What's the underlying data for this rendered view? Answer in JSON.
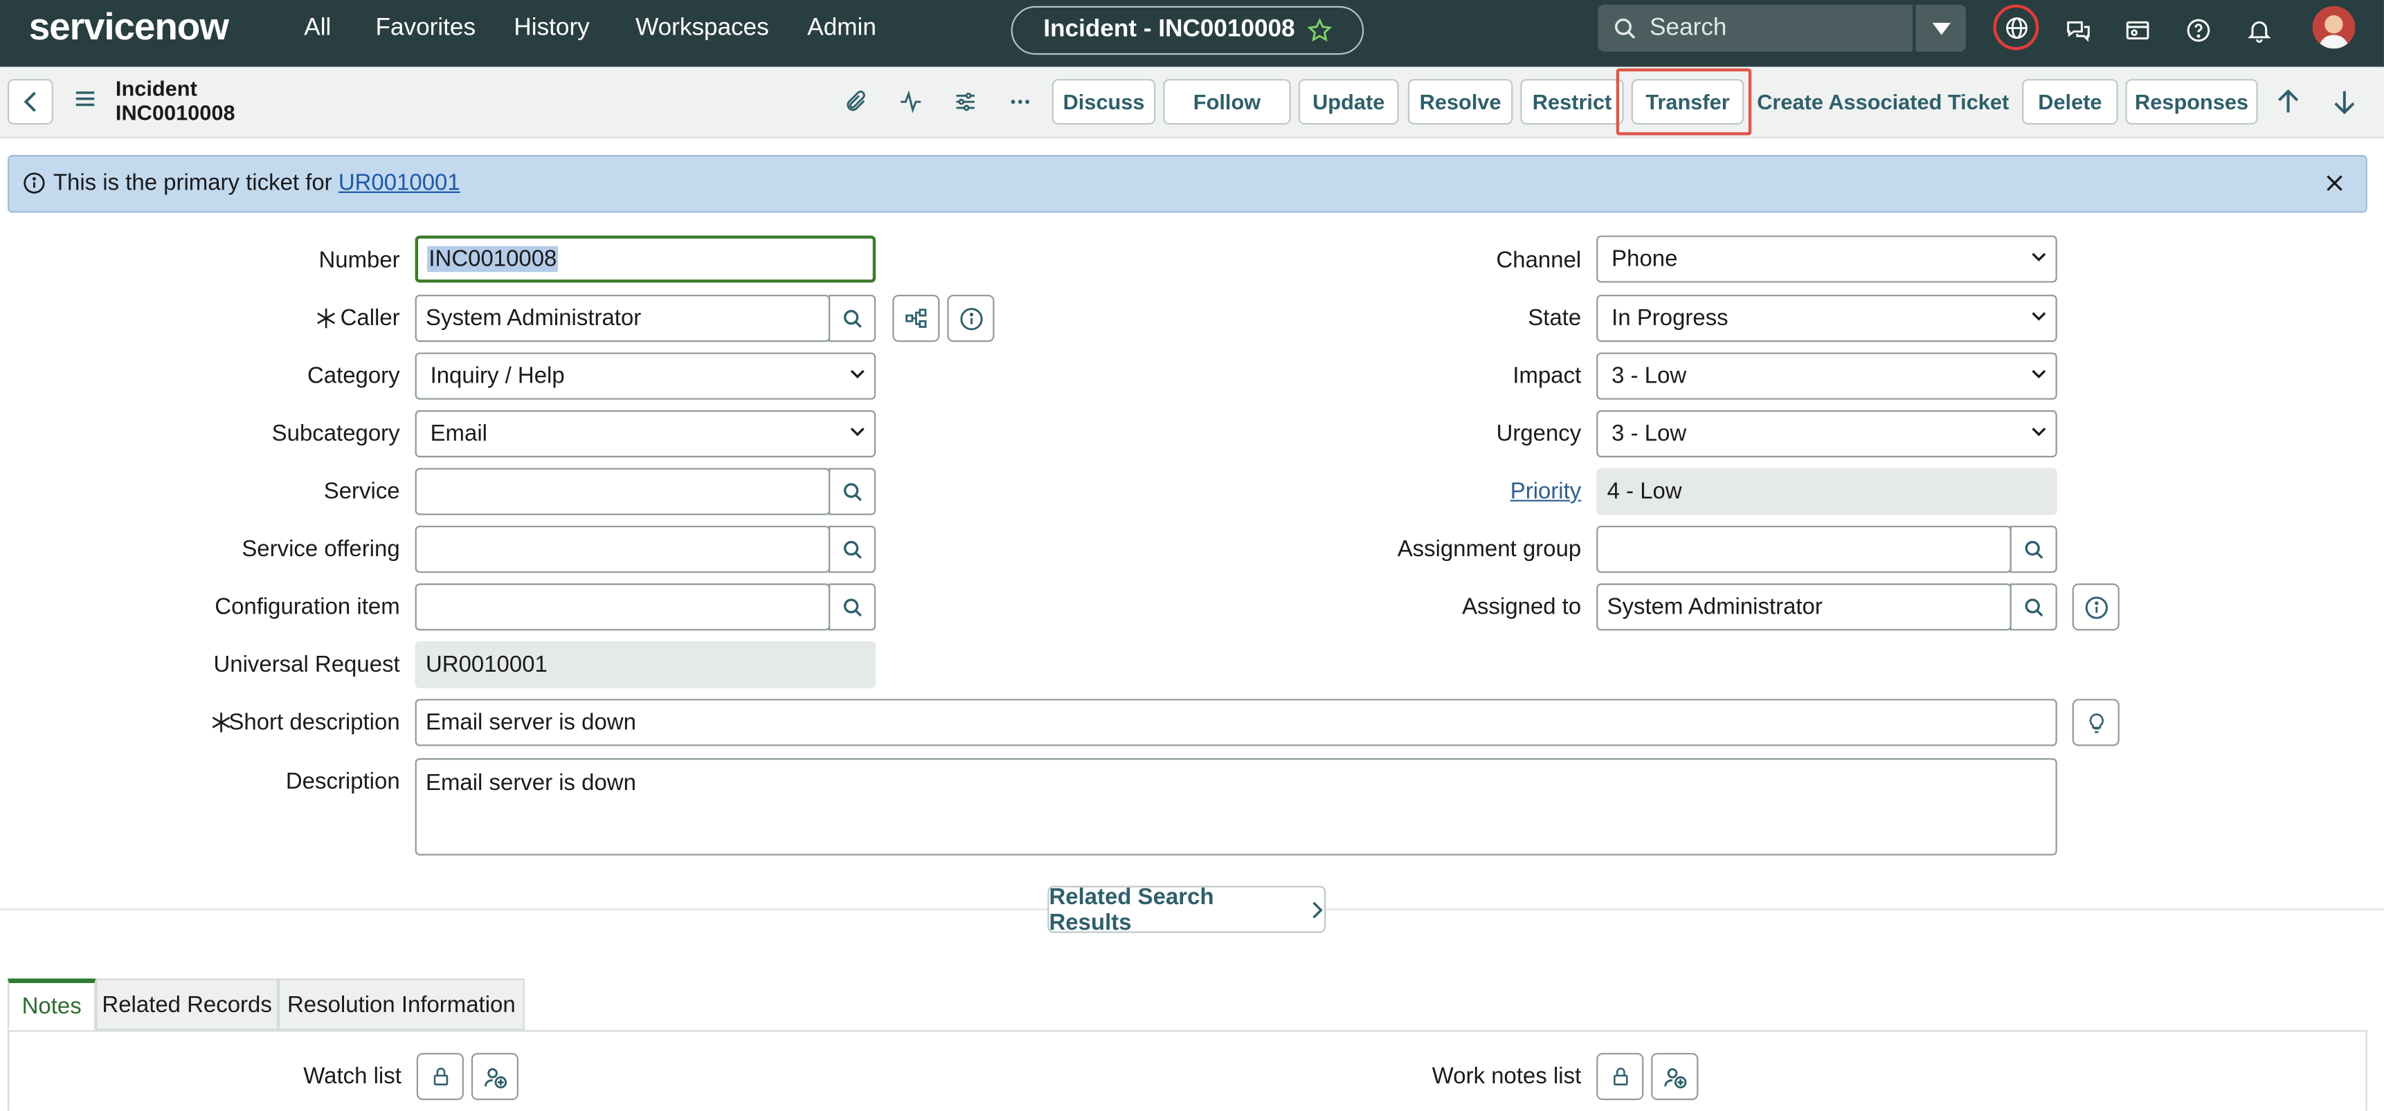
{
  "topnav": {
    "logo": "servicenow",
    "links": [
      "All",
      "Favorites",
      "History",
      "Workspaces",
      "Admin"
    ],
    "title_pill": "Incident - INC0010008",
    "search_placeholder": "Search"
  },
  "record": {
    "type": "Incident",
    "number": "INC0010008"
  },
  "actions": [
    "Discuss",
    "Follow",
    "Update",
    "Resolve",
    "Restrict",
    "Transfer",
    "Create Associated Ticket",
    "Delete",
    "Responses"
  ],
  "banner": {
    "text": "This is the primary ticket for",
    "link": "UR0010001"
  },
  "form": {
    "number": {
      "label": "Number",
      "value": "INC0010008"
    },
    "caller": {
      "label": "Caller",
      "value": "System Administrator"
    },
    "category": {
      "label": "Category",
      "value": "Inquiry / Help"
    },
    "subcategory": {
      "label": "Subcategory",
      "value": "Email"
    },
    "service": {
      "label": "Service",
      "value": ""
    },
    "service_offering": {
      "label": "Service offering",
      "value": ""
    },
    "configuration_item": {
      "label": "Configuration item",
      "value": ""
    },
    "universal_request": {
      "label": "Universal Request",
      "value": "UR0010001"
    },
    "short_description": {
      "label": "Short description",
      "value": "Email server is down"
    },
    "description": {
      "label": "Description",
      "value": "Email server is down"
    },
    "channel": {
      "label": "Channel",
      "value": "Phone"
    },
    "state": {
      "label": "State",
      "value": "In Progress"
    },
    "impact": {
      "label": "Impact",
      "value": "3 - Low"
    },
    "urgency": {
      "label": "Urgency",
      "value": "3 - Low"
    },
    "priority": {
      "label": "Priority",
      "value": "4 - Low"
    },
    "assignment_group": {
      "label": "Assignment group",
      "value": ""
    },
    "assigned_to": {
      "label": "Assigned to",
      "value": "System Administrator"
    }
  },
  "related_search": "Related Search Results",
  "tabs": [
    "Notes",
    "Related Records",
    "Resolution Information"
  ],
  "notes": {
    "watch_list": "Watch list",
    "work_notes_list": "Work notes list"
  },
  "colors": {
    "nav_bg": "#293e40",
    "accent_green": "#2e7d32",
    "highlight": "#e0574a",
    "banner_bg": "#c3d9ee"
  }
}
